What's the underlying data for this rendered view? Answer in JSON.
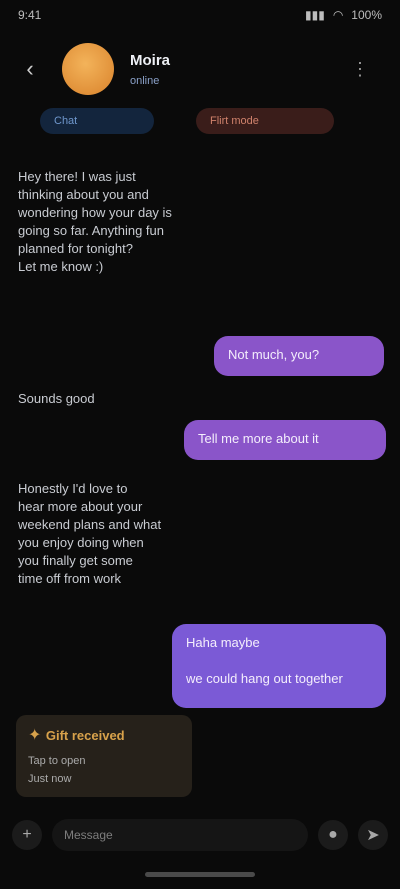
{
  "status": {
    "time": "9:41",
    "battery": "100%"
  },
  "header": {
    "back_icon": "back-arrow-icon",
    "name": "Moira",
    "subtitle": "online",
    "action_icon": "more-icon"
  },
  "chips": {
    "a": "Chat",
    "b": "Flirt mode"
  },
  "messages": {
    "m1": {
      "lines": [
        "Hey there! I was just",
        "thinking about you and",
        "wondering how your day is",
        "going so far. Anything fun",
        "planned for tonight?",
        "Let me know :)"
      ]
    },
    "m2": {
      "text": "Not much, you?"
    },
    "m3": {
      "text": "Sounds good"
    },
    "m4": {
      "text": "Tell me more about it"
    },
    "m5": {
      "lines": [
        "Honestly I'd love to",
        "hear more about your",
        "weekend plans and what",
        "you enjoy doing when",
        "you finally get some",
        "time off from work"
      ]
    },
    "m6": {
      "lines": [
        "Haha maybe",
        "we could hang out together"
      ]
    }
  },
  "attachment": {
    "title": "Gift received",
    "sub": "Tap to open",
    "sub2": "Just now"
  },
  "composer": {
    "placeholder": "Message"
  }
}
